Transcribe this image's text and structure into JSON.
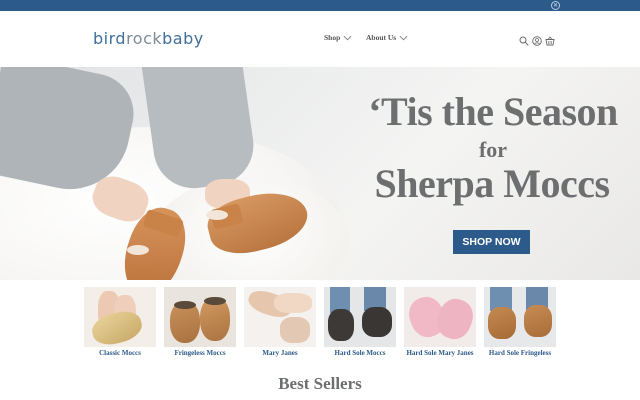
{
  "announcement_bar": {
    "close_icon": "close-icon",
    "color": "#2c5a8a"
  },
  "header": {
    "logo": {
      "part1": "bird",
      "part2": "rock",
      "part3": "baby"
    },
    "nav": [
      {
        "label": "Shop",
        "icon": "chevron-down-icon"
      },
      {
        "label": "About Us",
        "icon": "chevron-down-icon"
      }
    ],
    "icons": [
      "search-icon",
      "account-icon",
      "cart-icon"
    ]
  },
  "hero": {
    "line1": "‘Tis the Season",
    "line2": "for",
    "line3": "Sherpa Moccs",
    "cta_label": "SHOP NOW",
    "cta_color": "#2c5a8a"
  },
  "categories": [
    {
      "label": "Classic Moccs"
    },
    {
      "label": "Fringeless Moccs"
    },
    {
      "label": "Mary Janes"
    },
    {
      "label": "Hard Sole Moccs"
    },
    {
      "label": "Hard Sole Mary Janes"
    },
    {
      "label": "Hard Sole Fringeless"
    }
  ],
  "best_sellers": {
    "heading": "Best Sellers"
  }
}
